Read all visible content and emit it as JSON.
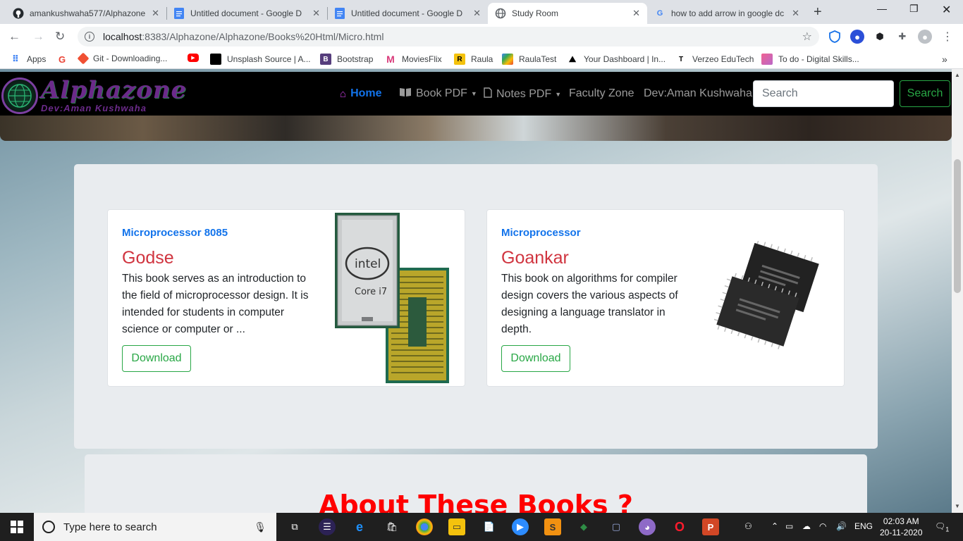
{
  "tabs": [
    {
      "title": "amankushwaha577/Alphazone",
      "fav": "github-icon"
    },
    {
      "title": "Untitled document - Google D",
      "fav": "google-docs-icon"
    },
    {
      "title": "Untitled document - Google D",
      "fav": "google-docs-icon"
    },
    {
      "title": "Study Room",
      "fav": "globe-icon"
    },
    {
      "title": "how to add arrow in google dc",
      "fav": "google-icon"
    }
  ],
  "omnibox": {
    "host": "localhost",
    "path": ":8383/Alphazone/Alphazone/Books%20Html/Micro.html"
  },
  "bookmarks": [
    {
      "label": "Apps"
    },
    {
      "label": ""
    },
    {
      "label": "Git - Downloading..."
    },
    {
      "label": ""
    },
    {
      "label": "Unsplash Source | A..."
    },
    {
      "label": "Bootstrap"
    },
    {
      "label": "MoviesFlix"
    },
    {
      "label": "Raula"
    },
    {
      "label": "RaulaTest"
    },
    {
      "label": "Your Dashboard | In..."
    },
    {
      "label": "Verzeo EduTech"
    },
    {
      "label": "To do - Digital Skills..."
    }
  ],
  "site": {
    "brand": "Alphazone",
    "dev_tag": "Dev:Aman Kushwaha",
    "nav": {
      "home": "Home",
      "book_pdf": "Book PDF",
      "notes_pdf": "Notes PDF",
      "faculty": "Faculty Zone",
      "dev": "Dev:Aman Kushwaha"
    },
    "search_placeholder": "Search",
    "search_button": "Search"
  },
  "books": [
    {
      "subtitle": "Microprocessor 8085",
      "author": "Godse",
      "description": "This book serves as an introduction to the field of microprocessor design. It is intended for students in computer science or computer or ...",
      "button": "Download",
      "image": "intel-core-i7-chip"
    },
    {
      "subtitle": "Microprocessor",
      "author": "Goankar",
      "description": "This book on algorithms for compiler design covers the various aspects of designing a language translator in depth.",
      "button": "Download",
      "image": "cpu-chips"
    }
  ],
  "about": {
    "heading": "About These Books ?"
  },
  "taskbar": {
    "search_placeholder": "Type here to search",
    "lang": "ENG",
    "time": "02:03 AM",
    "date": "20-11-2020",
    "notifications": "1"
  }
}
